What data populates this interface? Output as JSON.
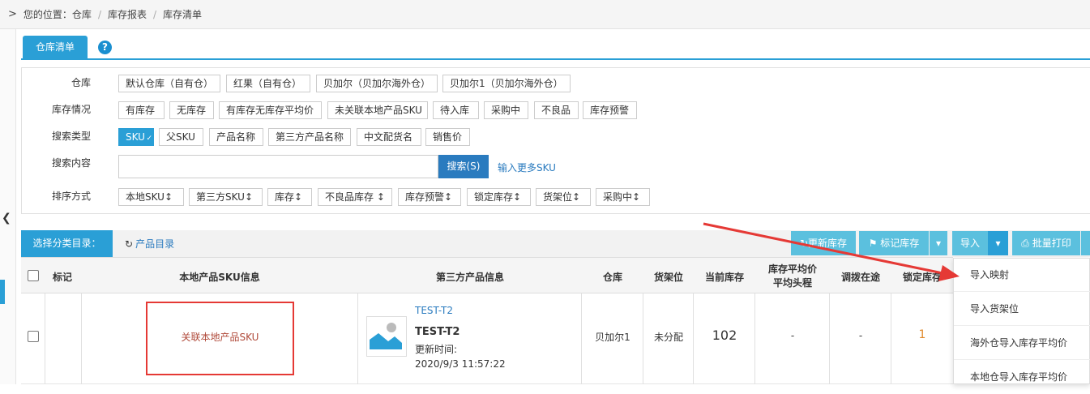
{
  "breadcrumb": {
    "prefix": "您的位置：",
    "items": [
      "仓库",
      "库存报表",
      "库存清单"
    ]
  },
  "tab": {
    "label": "仓库清单",
    "help": "?"
  },
  "filters": {
    "warehouse": {
      "label": "仓库",
      "options": [
        "默认仓库（自有仓）",
        "红果（自有仓）",
        "贝加尔（贝加尔海外仓）",
        "贝加尔1（贝加尔海外仓）"
      ]
    },
    "stock": {
      "label": "库存情况",
      "options": [
        "有库存",
        "无库存",
        "有库存无库存平均价",
        "未关联本地产品SKU",
        "待入库",
        "采购中",
        "不良品",
        "库存预警"
      ]
    },
    "search_type": {
      "label": "搜索类型",
      "options": [
        "SKU",
        "父SKU",
        "产品名称",
        "第三方产品名称",
        "中文配货名",
        "销售价"
      ],
      "selected": "SKU"
    },
    "search_content": {
      "label": "搜索内容",
      "value": "",
      "button": "搜索(S)",
      "more": "输入更多SKU"
    },
    "sort": {
      "label": "排序方式",
      "options": [
        "本地SKU↕",
        "第三方SKU↕",
        "库存↕",
        "不良品库存 ↕",
        "库存预警↕",
        "锁定库存↕",
        "货架位↕",
        "采购中↕"
      ]
    }
  },
  "toolbar": {
    "category_label": "选择分类目录：",
    "category_link": "产品目录",
    "update_stock": "更新库存",
    "mark_stock": "标记库存",
    "import": "导入",
    "batch_print": "批量打印"
  },
  "table": {
    "headers": [
      "标记",
      "本地产品SKU信息",
      "第三方产品信息",
      "仓库",
      "货架位",
      "当前库存",
      "库存平均价",
      "平均头程",
      "调拨在途",
      "锁定库存"
    ],
    "rows": [
      {
        "local_sku": "关联本地产品SKU",
        "third_sku_link": "TEST-T2",
        "third_sku_name": "TEST-T2",
        "update_label": "更新时间:",
        "update_time": "2020/9/3 11:57:22",
        "warehouse": "贝加尔1",
        "shelf": "未分配",
        "current_stock": "102",
        "avg_price": "-",
        "in_transit": "-",
        "locked": "1"
      }
    ]
  },
  "import_menu": [
    "导入映射",
    "导入货架位",
    "海外仓导入库存平均价",
    "本地仓导入库存平均价"
  ],
  "colors": {
    "accent": "#2a9fd6",
    "link": "#2a7bbf",
    "highlight_red": "#e53935",
    "orange": "#e08a2c"
  }
}
